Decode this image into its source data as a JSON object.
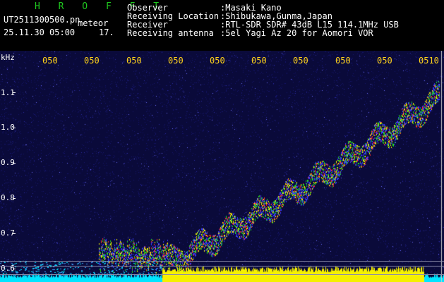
{
  "header": {
    "brand": "H R O F F T",
    "filename": "UT2511300500.pn",
    "meteor_label": "meteor",
    "datetime": "25.11.30 05:00",
    "count": "17.",
    "fields": [
      {
        "label": "Observer",
        "value": ":Masaki Kano"
      },
      {
        "label": "Receiving Location",
        "value": ":Shibukawa,Gunma,Japan"
      },
      {
        "label": "Receiver",
        "value": ":RTL-SDR SDR# 43dB L15 114.1MHz USB"
      },
      {
        "label": "Receiving antenna",
        "value": ":5el Yagi Az 20 for Aomori VOR"
      }
    ]
  },
  "axis": {
    "y_unit": "kHz",
    "y_ticks": [
      "1.1",
      "1.0",
      "0.9",
      "0.8",
      "0.7",
      "0.6"
    ],
    "x_ticks": [
      "050",
      "050",
      "050",
      "050",
      "050",
      "050",
      "050",
      "050",
      "050",
      "050",
      "0510"
    ]
  },
  "colors": {
    "background": "#000000",
    "plot_bg": "#0a0a3a",
    "brand": "#1fc71f",
    "tick_label": "#ffd21a",
    "signal_yellow": "#f5f000",
    "signal_cyan": "#00e5ff"
  }
}
